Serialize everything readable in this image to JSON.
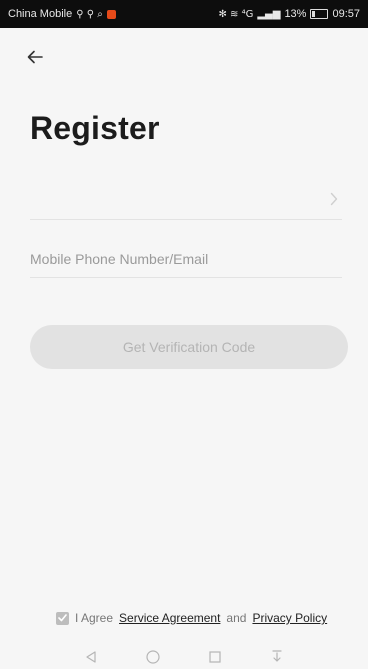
{
  "status_bar": {
    "carrier": "China Mobile",
    "carrier_icons": "⚲ ⚲ ⌕",
    "right_icons": "✻ ≋ ⁴G",
    "signal": "▂▄▆",
    "battery_percent": "13%",
    "time": "09:57"
  },
  "header": {
    "back_icon": "arrow-left",
    "title": "Register"
  },
  "form": {
    "region_value": "",
    "phone_placeholder": "Mobile Phone Number/Email",
    "get_code_label": "Get Verification Code"
  },
  "agreement": {
    "prefix": "I Agree",
    "service_agreement": "Service Agreement",
    "and_text": "and",
    "privacy_policy": "Privacy Policy",
    "checked": true
  },
  "colors": {
    "background": "#f6f6f6",
    "title": "#1c1c1c",
    "button_disabled_bg": "#e2e2e2",
    "button_disabled_text": "#b4b4b4",
    "status_bar_bg": "#0d0d0d"
  }
}
